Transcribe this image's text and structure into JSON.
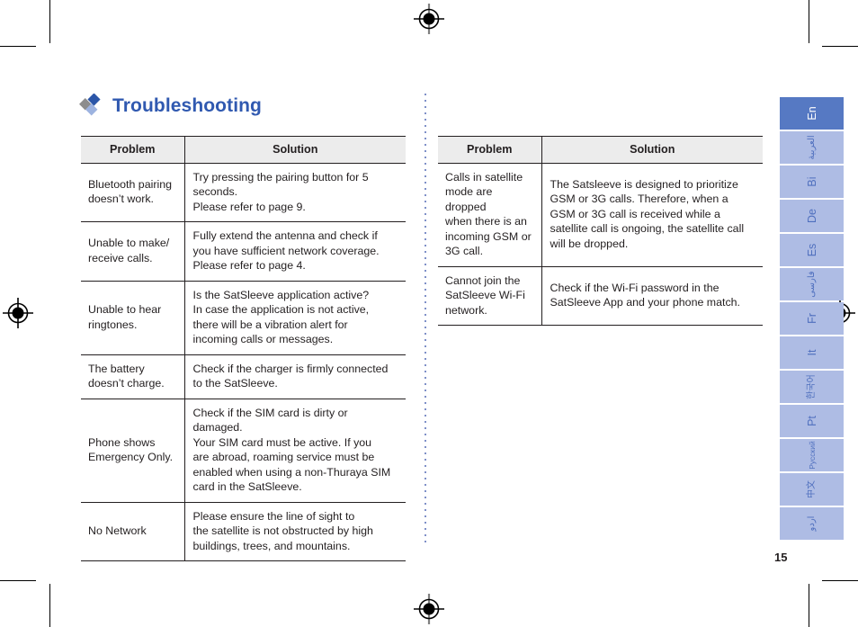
{
  "document": {
    "title": "Troubleshooting",
    "page_number": "15",
    "title_color": "#3059b0",
    "accent_color": "#5679c3",
    "tab_color": "#aebce4"
  },
  "tables": {
    "headers": {
      "problem": "Problem",
      "solution": "Solution"
    },
    "left_rows": [
      {
        "problem": "Bluetooth pairing\ndoesn’t work.",
        "solution": "Try pressing the pairing button for 5\nseconds.\nPlease refer to page 9."
      },
      {
        "problem": "Unable to  make/\nreceive calls.",
        "solution": "Fully extend the antenna and check if\nyou have sufficient network coverage.\nPlease refer to page 4."
      },
      {
        "problem": "Unable to hear\nringtones.",
        "solution": "Is the SatSleeve application active?\nIn case the application is not active,\nthere will be a vibration alert for\nincoming calls or messages."
      },
      {
        "problem": "The battery\ndoesn’t charge.",
        "solution": "Check if the charger is firmly connected\nto the SatSleeve."
      },
      {
        "problem": "Phone shows\nEmergency Only.",
        "solution": "Check if the SIM card is dirty or\ndamaged.\nYour SIM card must be active. If you\nare abroad, roaming service must be\nenabled when using a non-Thuraya SIM\ncard in the SatSleeve."
      },
      {
        "problem": "No Network",
        "solution": "Please ensure the line of sight to\nthe satellite is not obstructed by high\nbuildings, trees, and mountains."
      }
    ],
    "right_rows": [
      {
        "problem": "Calls in satellite\nmode are dropped\nwhen there is an\nincoming GSM or\n3G call.",
        "solution": "The Satsleeve is designed  to prioritize\nGSM or 3G calls. Therefore, when a\nGSM or 3G call is received while a\nsatellite call is ongoing, the satellite call\nwill be dropped."
      },
      {
        "problem": "Cannot join the\nSatSleeve Wi-Fi\nnetwork.",
        "solution": "Check if the Wi-Fi password in the\nSatSleeve App and your phone match."
      }
    ]
  },
  "language_tabs": [
    {
      "label": "En",
      "active": true,
      "size": "normal"
    },
    {
      "label": "العربية",
      "active": false,
      "size": "small"
    },
    {
      "label": "Bi",
      "active": false,
      "size": "normal"
    },
    {
      "label": "De",
      "active": false,
      "size": "normal"
    },
    {
      "label": "Es",
      "active": false,
      "size": "normal"
    },
    {
      "label": "فارسی",
      "active": false,
      "size": "small"
    },
    {
      "label": "Fr",
      "active": false,
      "size": "normal"
    },
    {
      "label": "It",
      "active": false,
      "size": "normal"
    },
    {
      "label": "한국어",
      "active": false,
      "size": "small"
    },
    {
      "label": "Pt",
      "active": false,
      "size": "normal"
    },
    {
      "label": "Русский",
      "active": false,
      "size": "tiny"
    },
    {
      "label": "中文",
      "active": false,
      "size": "small"
    },
    {
      "label": "اردو",
      "active": false,
      "size": "small"
    }
  ]
}
